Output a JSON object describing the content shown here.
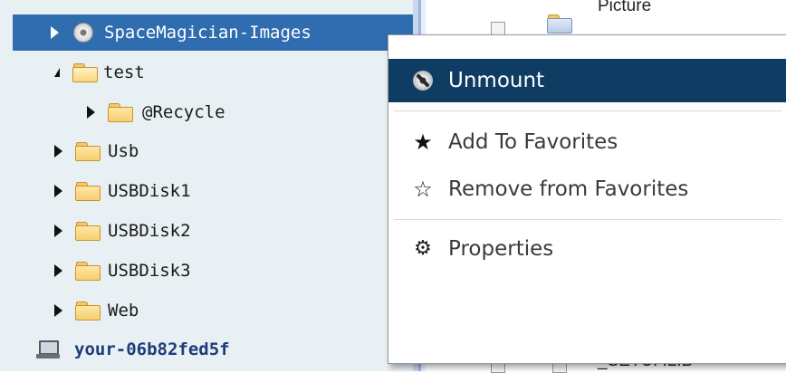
{
  "tree": {
    "items": [
      {
        "label": "SpaceMagician-Images",
        "icon": "disc-icon",
        "expander": "collapsed",
        "selected": true
      },
      {
        "label": "test",
        "icon": "folder-open-icon",
        "expander": "expanded"
      },
      {
        "label": "@Recycle",
        "icon": "folder-icon",
        "expander": "collapsed"
      },
      {
        "label": "Usb",
        "icon": "folder-icon",
        "expander": "collapsed"
      },
      {
        "label": "USBDisk1",
        "icon": "folder-icon",
        "expander": "collapsed"
      },
      {
        "label": "USBDisk2",
        "icon": "folder-icon",
        "expander": "collapsed"
      },
      {
        "label": "USBDisk3",
        "icon": "folder-icon",
        "expander": "collapsed"
      },
      {
        "label": "Web",
        "icon": "folder-icon",
        "expander": "collapsed"
      }
    ],
    "host": {
      "label": "your-06b82fed5f",
      "icon": "computer-icon"
    }
  },
  "filelist": {
    "top_item": "Picture",
    "bottom_item": "_SETUP.LIB"
  },
  "context_menu": {
    "items": [
      {
        "label": "Unmount",
        "icon": "unmount-icon",
        "active": true
      },
      {
        "label": "Add To Favorites",
        "icon": "star-filled-icon"
      },
      {
        "label": "Remove from Favorites",
        "icon": "star-outline-icon"
      },
      {
        "label": "Properties",
        "icon": "gear-icon"
      }
    ]
  },
  "colors": {
    "tree_bg": "#e9f0f4",
    "tree_selected": "#2f6db0",
    "menu_active": "#0e3c63",
    "host_text": "#1f3c78"
  }
}
